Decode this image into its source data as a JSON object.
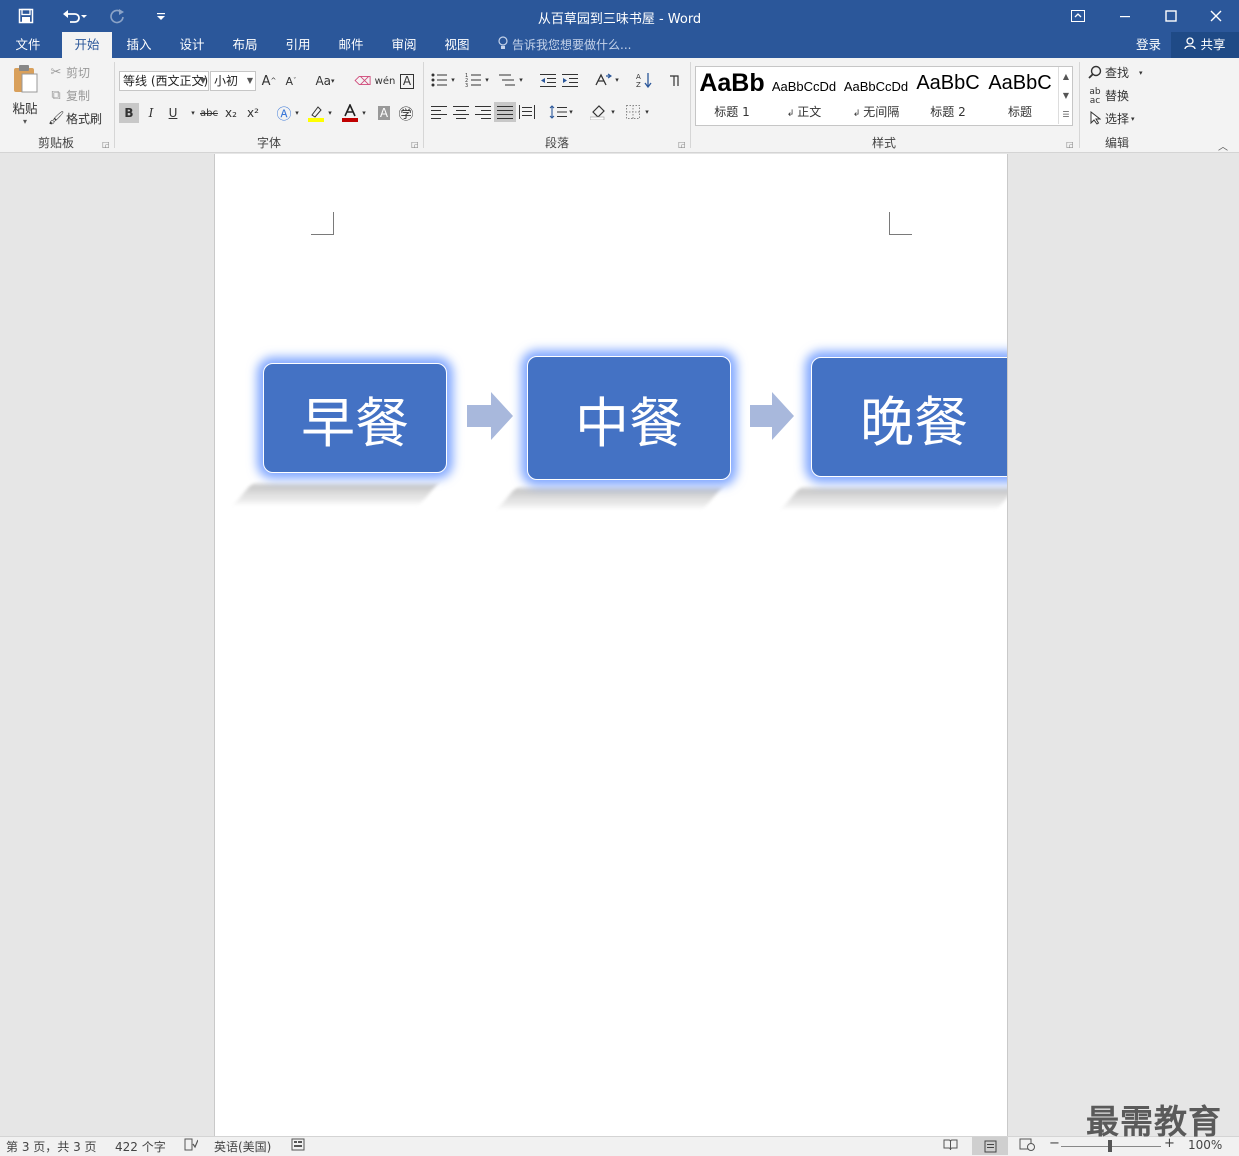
{
  "window": {
    "title": "从百草园到三味书屋 - Word",
    "qat_icons": [
      "save-icon",
      "undo-icon",
      "redo-icon",
      "customize-qat-icon"
    ],
    "controls": [
      "ribbon-display-icon",
      "minimize-icon",
      "maximize-icon",
      "close-icon"
    ]
  },
  "tabs": [
    "文件",
    "开始",
    "插入",
    "设计",
    "布局",
    "引用",
    "邮件",
    "审阅",
    "视图"
  ],
  "active_tab": "开始",
  "tell_me": "告诉我您想要做什么...",
  "account": {
    "login": "登录",
    "share": "共享"
  },
  "clipboard": {
    "label": "剪贴板",
    "paste": "粘贴",
    "cut": "剪切",
    "copy": "复制",
    "format_painter": "格式刷"
  },
  "font": {
    "label": "字体",
    "font_name": "等线 (西文正文)",
    "font_size": "小初",
    "bold": "B",
    "italic": "I",
    "underline": "U",
    "strike": "abc",
    "subscript": "x₂",
    "superscript": "x²",
    "grow": "A",
    "shrink": "A",
    "change_case": "Aa"
  },
  "paragraph": {
    "label": "段落"
  },
  "styles": {
    "label": "样式",
    "items": [
      {
        "sample": "AaBb",
        "name": "标题 1"
      },
      {
        "sample": "AaBbCcDd",
        "name": "正文"
      },
      {
        "sample": "AaBbCcDd",
        "name": "无间隔"
      },
      {
        "sample": "AaBbC",
        "name": "标题 2"
      },
      {
        "sample": "AaBbC",
        "name": "标题"
      }
    ]
  },
  "editing": {
    "label": "编辑",
    "find": "查找",
    "replace": "替换",
    "select": "选择"
  },
  "document": {
    "smartart": [
      "早餐",
      "中餐",
      "晚餐"
    ],
    "colors": {
      "box": "#4472c4",
      "glow": "#5a8cff",
      "arrow": "#a8b8dc"
    }
  },
  "status": {
    "page": "第 3 页，共 3 页",
    "words": "422 个字",
    "language": "英语(美国)",
    "zoom": "100%"
  },
  "watermark": "最需教育"
}
